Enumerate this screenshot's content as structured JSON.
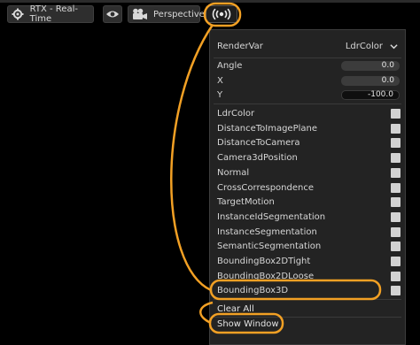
{
  "toolbar": {
    "renderer_label": "RTX - Real-Time",
    "camera_label": "Perspective",
    "sensor_label": "((•))"
  },
  "panel": {
    "render_var_label": "RenderVar",
    "render_var_value": "LdrColor",
    "fields": [
      {
        "label": "Angle",
        "value": "0.0"
      },
      {
        "label": "X",
        "value": "0.0"
      },
      {
        "label": "Y",
        "value": "-100.0"
      }
    ],
    "items": [
      "LdrColor",
      "DistanceToImagePlane",
      "DistanceToCamera",
      "Camera3dPosition",
      "Normal",
      "CrossCorrespondence",
      "TargetMotion",
      "InstanceIdSegmentation",
      "InstanceSegmentation",
      "SemanticSegmentation",
      "BoundingBox2DTight",
      "BoundingBox2DLoose",
      "BoundingBox3D"
    ],
    "clear_all_label": "Clear All",
    "show_window_label": "Show Window"
  },
  "colors": {
    "highlight": "#f2a024",
    "background": "#000000",
    "panel": "#232323",
    "checkbox": "#d2d2d2"
  }
}
